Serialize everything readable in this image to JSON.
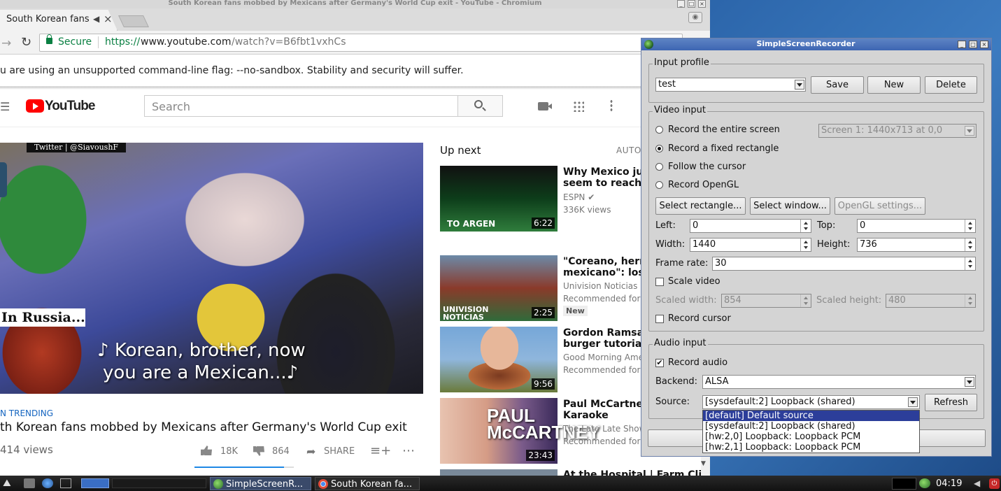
{
  "browser": {
    "window_title": "South Korean fans mobbed by Mexicans after Germany's World Cup exit - YouTube - Chromium",
    "tab_title": "South Korean fans",
    "security_label": "Secure",
    "url_scheme": "https://",
    "url_host": "www.youtube.com",
    "url_path": "/watch?v=B6fbt1vxhCs",
    "infobar_text": "u are using an unsupported command-line flag: --no-sandbox. Stability and security will suffer."
  },
  "youtube": {
    "logo_text": "YouTube",
    "search_placeholder": "Search",
    "player": {
      "watermark": "Twitter | @SiavoushF",
      "lower_third": "In Russia...",
      "subtitle_line1": "♪ Korean, brother, now",
      "subtitle_line2": "you are a Mexican...♪"
    },
    "trending_label": "N TRENDING",
    "video_title": "th Korean fans mobbed by Mexicans after Germany's World Cup exit",
    "view_count": "414 views",
    "actions": {
      "likes": "18K",
      "dislikes": "864",
      "share": "SHARE"
    },
    "likes_ratio": 0.9,
    "up_next_label": "Up next",
    "autoplay_label": "AUTO",
    "related": [
      {
        "title": "Why Mexico just c\nseem to reach the",
        "channel": "ESPN",
        "views": "336K views",
        "duration": "6:22",
        "thumb_text": "TO ARGEN"
      },
      {
        "title": "\"Coreano, herman\nmexicano\": los cá",
        "channel": "Univision Noticias",
        "views": "Recommended for",
        "duration": "2:25",
        "badge": "New",
        "thumb_text": "UNIVISION NOTICIAS"
      },
      {
        "title": "Gordon Ramsay's\nburger tutorial",
        "channel": "Good Morning Ame",
        "views": "Recommended for",
        "duration": "9:56"
      },
      {
        "title": "Paul McCartney C\nKaraoke",
        "channel": "The Late Late Show",
        "views": "Recommended for",
        "duration": "23:43",
        "thumb_text": "PAUL\nMcCARTNEY"
      },
      {
        "title": "At the Hospital | Farm Clip"
      }
    ]
  },
  "ssr": {
    "title": "SimpleScreenRecorder",
    "input_profile": {
      "group_title": "Input profile",
      "profile_value": "test",
      "save": "Save",
      "new": "New",
      "delete": "Delete"
    },
    "video_input": {
      "group_title": "Video input",
      "record_entire_screen": "Record the entire screen",
      "screen_select": "Screen 1: 1440x713 at 0,0",
      "record_fixed_rect": "Record a fixed rectangle",
      "follow_cursor": "Follow the cursor",
      "record_opengl": "Record OpenGL",
      "select_rectangle": "Select rectangle...",
      "select_window": "Select window...",
      "opengl_settings": "OpenGL settings...",
      "left_label": "Left:",
      "left_value": "0",
      "top_label": "Top:",
      "top_value": "0",
      "width_label": "Width:",
      "width_value": "1440",
      "height_label": "Height:",
      "height_value": "736",
      "frame_rate_label": "Frame rate:",
      "frame_rate_value": "30",
      "scale_video": "Scale video",
      "scaled_width_label": "Scaled width:",
      "scaled_width_value": "854",
      "scaled_height_label": "Scaled height:",
      "scaled_height_value": "480",
      "record_cursor": "Record cursor"
    },
    "audio_input": {
      "group_title": "Audio input",
      "record_audio": "Record audio",
      "backend_label": "Backend:",
      "backend_value": "ALSA",
      "source_label": "Source:",
      "source_value": "[sysdefault:2] Loopback (shared)",
      "refresh": "Refresh",
      "source_options": [
        "[default] Default source",
        "[sysdefault:2] Loopback (shared)",
        "[hw:2,0] Loopback: Loopback PCM",
        "[hw:2,1] Loopback: Loopback PCM"
      ]
    }
  },
  "taskbar": {
    "task_ssr": "SimpleScreenR...",
    "task_chrome": "South Korean fa...",
    "clock": "04:19"
  }
}
